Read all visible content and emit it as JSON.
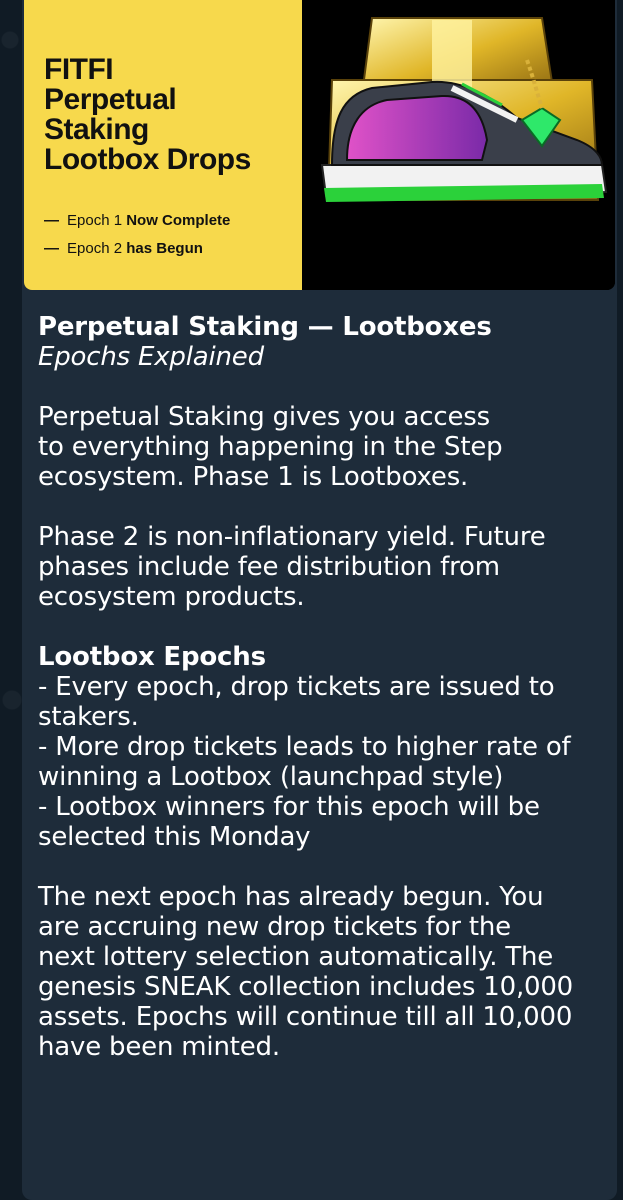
{
  "post_image": {
    "title_lines": [
      "FITFI",
      "Perpetual",
      "Staking",
      "Lootbox Drops"
    ],
    "epoch_1": {
      "prefix": "Epoch 1",
      "status": "Now Complete"
    },
    "epoch_2": {
      "prefix": "Epoch 2",
      "status": "has Begun"
    },
    "dash": "—"
  },
  "message": {
    "heading": "Perpetual Staking — Lootboxes",
    "subheading": "Epochs Explained",
    "para1": [
      "Perpetual Staking gives you access",
      "to everything happening in the Step",
      "ecosystem. Phase 1 is Lootboxes."
    ],
    "para2": [
      "Phase 2 is non-inflationary yield. Future",
      "phases include fee distribution from",
      "ecosystem products."
    ],
    "section_title": "Lootbox Epochs",
    "bullets": [
      "- Every epoch, drop tickets are issued to",
      "stakers.",
      "- More drop tickets leads to higher rate of",
      "winning a Lootbox (launchpad style)",
      "- Lootbox winners for this epoch will be",
      "selected this Monday"
    ],
    "para3": [
      "The next epoch has already begun. You",
      "are accruing new drop tickets for the",
      "next lottery selection automatically. The",
      "genesis SNEAK collection includes 10,000",
      "assets. Epochs will continue till all 10,000",
      "have been minted."
    ]
  }
}
